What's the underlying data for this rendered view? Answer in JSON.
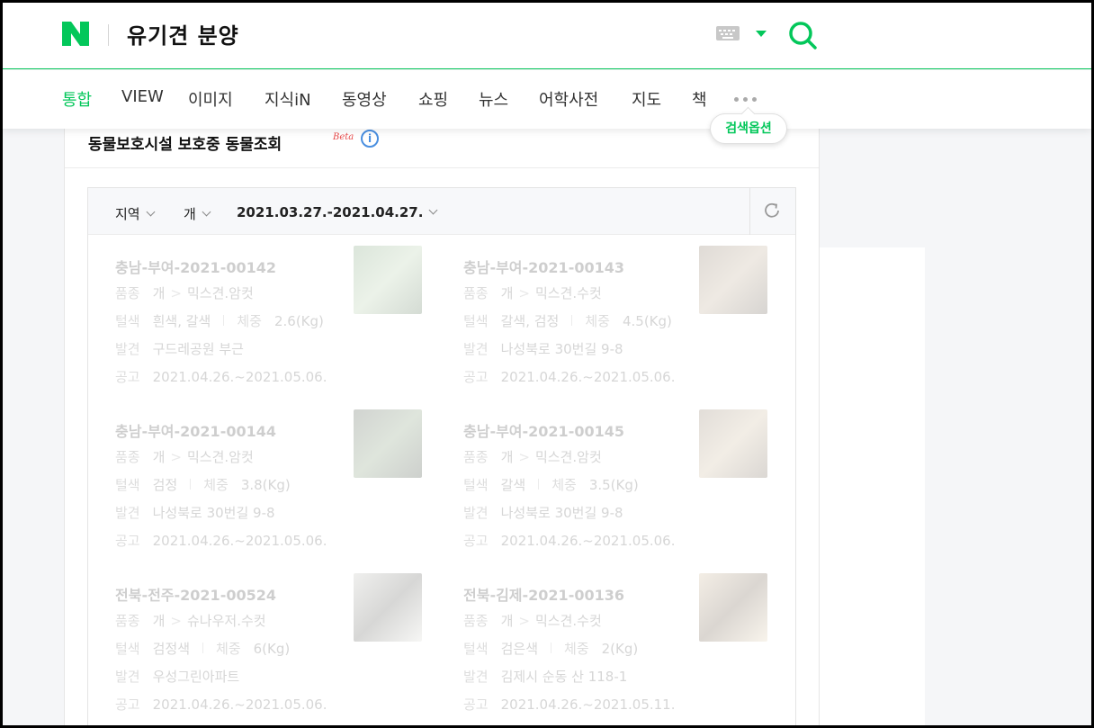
{
  "header": {
    "query": "유기견 분양"
  },
  "tabs": [
    {
      "label": "통합",
      "active": true
    },
    {
      "label": "VIEW",
      "active": false
    },
    {
      "label": "이미지",
      "active": false
    },
    {
      "label": "지식iN",
      "active": false
    },
    {
      "label": "동영상",
      "active": false
    },
    {
      "label": "쇼핑",
      "active": false
    },
    {
      "label": "뉴스",
      "active": false
    },
    {
      "label": "어학사전",
      "active": false
    },
    {
      "label": "지도",
      "active": false
    },
    {
      "label": "책",
      "active": false
    }
  ],
  "search_options_label": "검색옵션",
  "card": {
    "title": "동물보호시설 보호중 동물조회",
    "beta": "Beta",
    "info": "i"
  },
  "filters": {
    "region": "지역",
    "species": "개",
    "date_range": "2021.03.27.-2021.04.27."
  },
  "labels": {
    "breed": "품종",
    "color": "털색",
    "weight": "체중",
    "found": "발견",
    "notice": "공고",
    "gt": ">"
  },
  "animals": [
    {
      "id": "충남-부여-2021-00142",
      "species": "개",
      "breed": "믹스견.암컷",
      "color": "흰색, 갈색",
      "weight": "2.6(Kg)",
      "found": "구드레공원 부근",
      "notice": "2021.04.26.~2021.05.06."
    },
    {
      "id": "충남-부여-2021-00143",
      "species": "개",
      "breed": "믹스견.수컷",
      "color": "갈색, 검정",
      "weight": "4.5(Kg)",
      "found": "나성북로 30번길 9-8",
      "notice": "2021.04.26.~2021.05.06."
    },
    {
      "id": "충남-부여-2021-00144",
      "species": "개",
      "breed": "믹스견.암컷",
      "color": "검정",
      "weight": "3.8(Kg)",
      "found": "나성북로 30번길 9-8",
      "notice": "2021.04.26.~2021.05.06."
    },
    {
      "id": "충남-부여-2021-00145",
      "species": "개",
      "breed": "믹스견.암컷",
      "color": "갈색",
      "weight": "3.5(Kg)",
      "found": "나성북로 30번길 9-8",
      "notice": "2021.04.26.~2021.05.06."
    },
    {
      "id": "전북-전주-2021-00524",
      "species": "개",
      "breed": "슈나우저.수컷",
      "color": "검정색",
      "weight": "6(Kg)",
      "found": "우성그린아파트",
      "notice": "2021.04.26.~2021.05.06."
    },
    {
      "id": "전북-김제-2021-00136",
      "species": "개",
      "breed": "믹스견.수컷",
      "color": "검은색",
      "weight": "2(Kg)",
      "found": "김제시 순동 산 118-1",
      "notice": "2021.04.26.~2021.05.11."
    }
  ],
  "colors": {
    "brand": "#03c75a",
    "beta": "#e84a4a",
    "info": "#4a8fe0"
  }
}
